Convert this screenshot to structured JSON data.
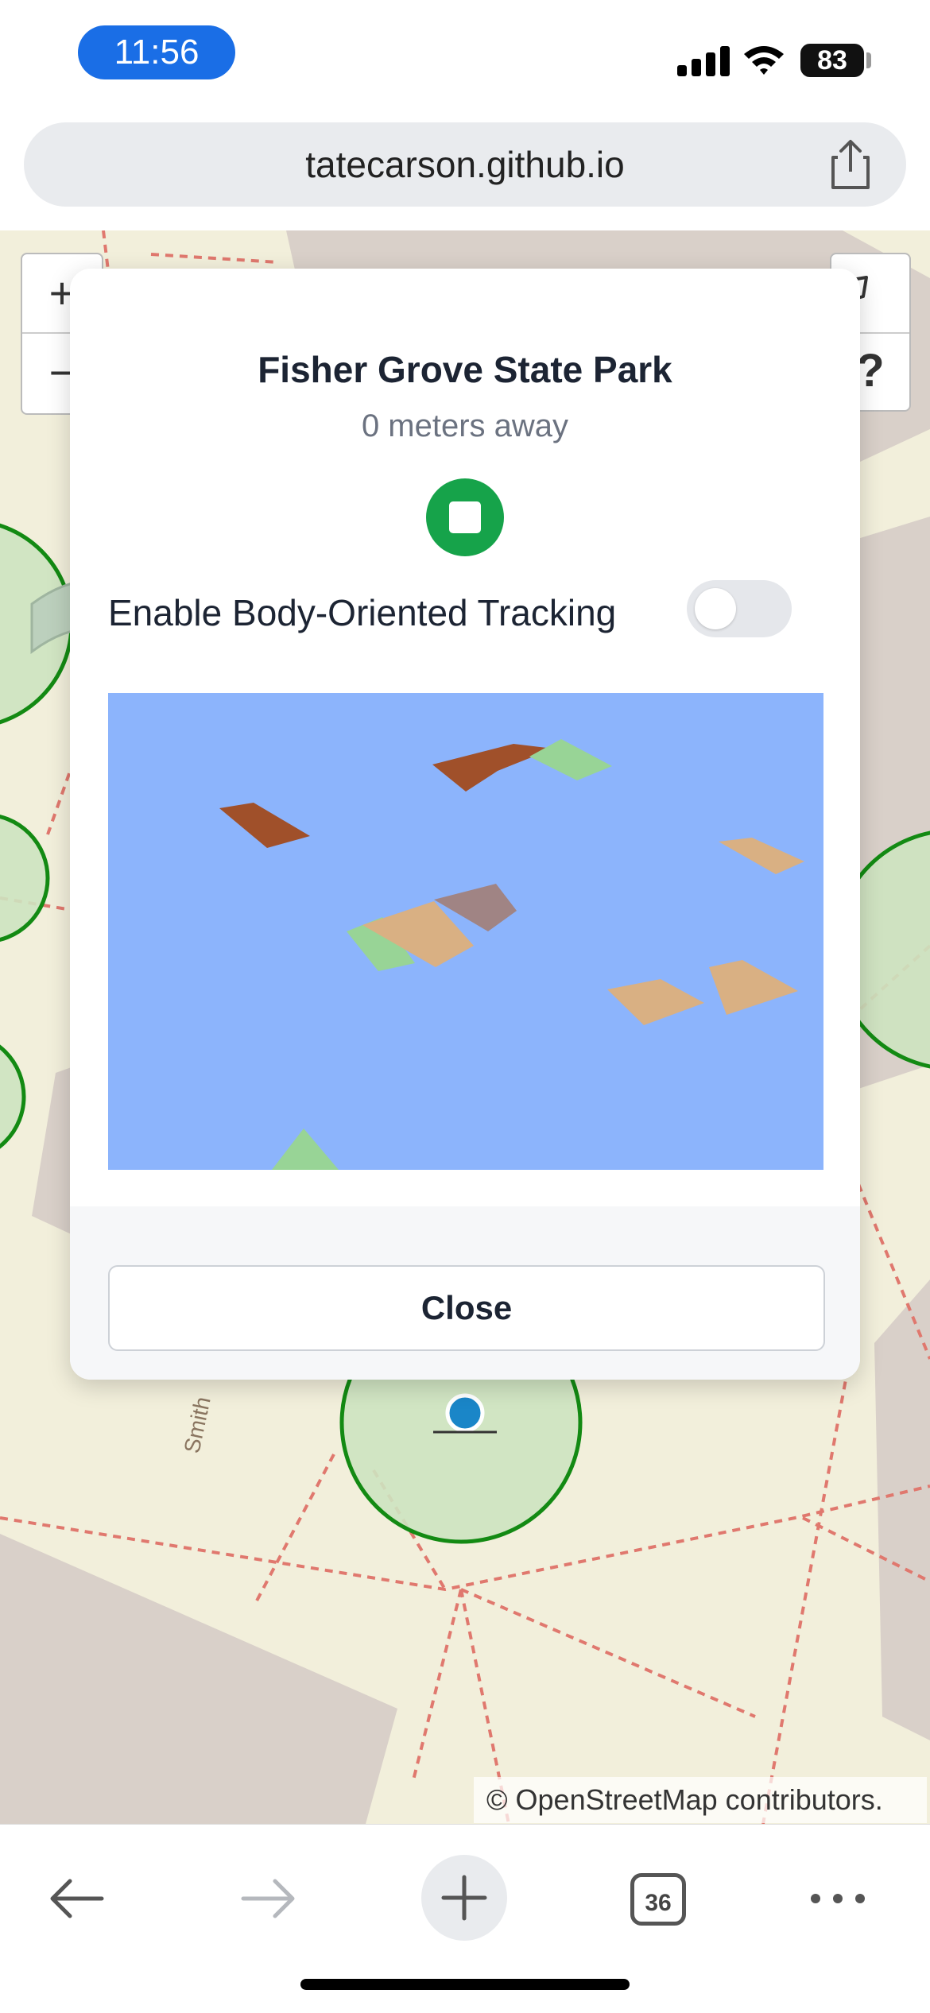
{
  "status_bar": {
    "time": "11:56",
    "battery": "83",
    "icons": [
      "signal-icon",
      "wifi-icon",
      "battery-icon"
    ]
  },
  "browser": {
    "url": "tatecarson.github.io",
    "share_icon": "share-icon"
  },
  "map": {
    "zoom_in_label": "+",
    "zoom_out_label": "−",
    "help_label": "?",
    "pin_icon": "pin-icon",
    "attribution": "© OpenStreetMap contributors.",
    "street_labels": [
      "Smith"
    ],
    "colors": {
      "background": "#f2efdb",
      "building": "#d9d0c9",
      "path": "#e0786e",
      "zone_fill": "#cde3c0",
      "zone_stroke": "#138a13",
      "user_marker": "#1a86c8"
    }
  },
  "modal": {
    "title": "Fisher Grove State Park",
    "subtitle": "0 meters away",
    "stop_button_icon": "stop-icon",
    "toggle_label": "Enable Body-Oriented Tracking",
    "toggle_on": false,
    "close_label": "Close",
    "scene": {
      "background": "#8cb4fc",
      "shape_colors": {
        "brown": "#a0502a",
        "green": "#98d496",
        "tan": "#d9b083",
        "mauve": "#a08484"
      }
    },
    "colors": {
      "title": "#1c2433",
      "subtitle": "#6b7280",
      "stop_button": "#16a34a"
    }
  },
  "toolbar": {
    "back_icon": "back-arrow-icon",
    "forward_icon": "forward-arrow-icon",
    "new_tab_icon": "plus-icon",
    "tab_count": "36",
    "more_icon": "more-icon"
  }
}
